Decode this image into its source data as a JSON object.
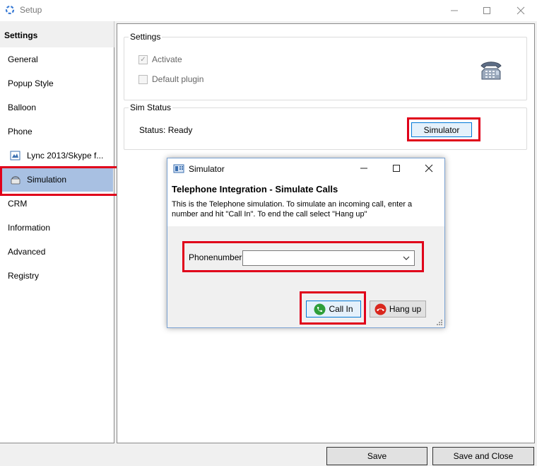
{
  "window": {
    "title": "Setup",
    "controls": {
      "minimize": "minimize",
      "maximize": "maximize",
      "close": "close"
    }
  },
  "sidebar": {
    "header": "Settings",
    "items": [
      {
        "label": "General"
      },
      {
        "label": "Popup Style"
      },
      {
        "label": "Balloon"
      },
      {
        "label": "Phone"
      },
      {
        "label": "Lync 2013/Skype f..."
      },
      {
        "label": "Simulation",
        "selected": true
      },
      {
        "label": "CRM"
      },
      {
        "label": "Information"
      },
      {
        "label": "Advanced"
      },
      {
        "label": "Registry"
      }
    ]
  },
  "settings_group": {
    "title": "Settings",
    "activate_label": "Activate",
    "activate_checked": true,
    "default_plugin_label": "Default plugin",
    "default_plugin_checked": false,
    "icon": "telephone-icon"
  },
  "sim_status_group": {
    "title": "Sim Status",
    "status_text": "Status: Ready",
    "simulator_button": "Simulator"
  },
  "footer": {
    "save": "Save",
    "save_and_close": "Save and Close"
  },
  "simulator_dialog": {
    "title": "Simulator",
    "heading": "Telephone Integration - Simulate Calls",
    "description": "This is the Telephone simulation. To simulate an incoming call, enter a number  and hit \"Call In\". To end the call select \"Hang up\"",
    "phonenumber_label": "Phonenumber",
    "phonenumber_value": "",
    "call_in_button": "Call In",
    "hang_up_button": "Hang up"
  },
  "colors": {
    "highlight_red": "#e0001a",
    "selection_blue": "#a8c0e2",
    "call_green": "#2e9e3a",
    "hangup_red": "#d9261c"
  }
}
